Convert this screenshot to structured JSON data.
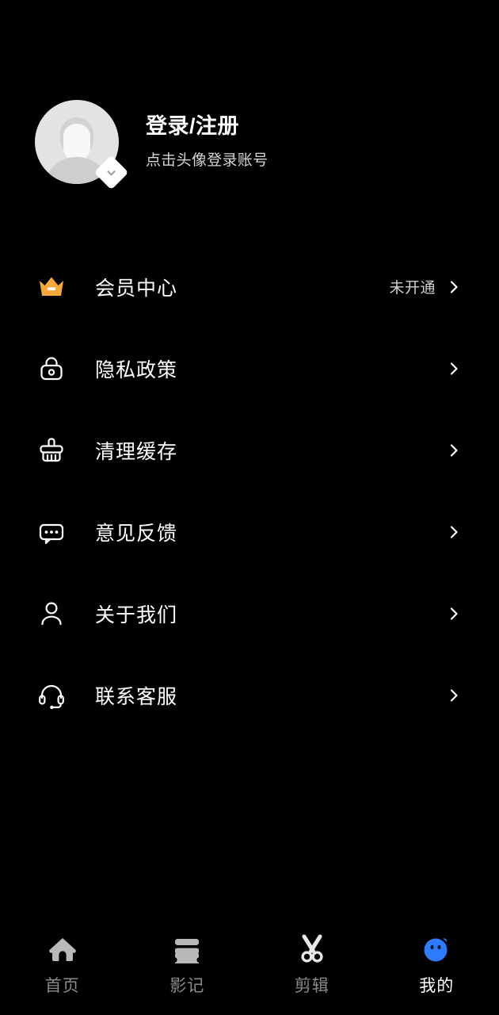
{
  "screen": {
    "title": "我的",
    "background": "#000000"
  },
  "profile": {
    "title": "登录/注册",
    "subtitle": "点击头像登录账号",
    "avatar_icon": "default-user-avatar",
    "badge_icon": "chevron-down-badge-icon"
  },
  "menu": {
    "items": [
      {
        "label": "会员中心",
        "icon": "crown-icon",
        "value": "未开通",
        "icon_color": "#F7A93C",
        "has_chevron": true
      },
      {
        "label": "隐私政策",
        "icon": "lock-icon",
        "value": "",
        "icon_color": "#FFFFFF",
        "has_chevron": true
      },
      {
        "label": "清理缓存",
        "icon": "broom-icon",
        "value": "",
        "icon_color": "#FFFFFF",
        "has_chevron": true
      },
      {
        "label": "意见反馈",
        "icon": "message-icon",
        "value": "",
        "icon_color": "#FFFFFF",
        "has_chevron": true
      },
      {
        "label": "关于我们",
        "icon": "person-icon",
        "value": "",
        "icon_color": "#FFFFFF",
        "has_chevron": true
      },
      {
        "label": "联系客服",
        "icon": "headset-icon",
        "value": "",
        "icon_color": "#FFFFFF",
        "has_chevron": true
      }
    ]
  },
  "bottom_nav": {
    "active_index": 3,
    "active_color": "#2E7BFF",
    "inactive_color": "#8A8A8A",
    "items": [
      {
        "label": "首页",
        "icon": "home-icon"
      },
      {
        "label": "影记",
        "icon": "film-ticket-icon"
      },
      {
        "label": "剪辑",
        "icon": "scissors-icon"
      },
      {
        "label": "我的",
        "icon": "profile-face-icon"
      }
    ]
  }
}
